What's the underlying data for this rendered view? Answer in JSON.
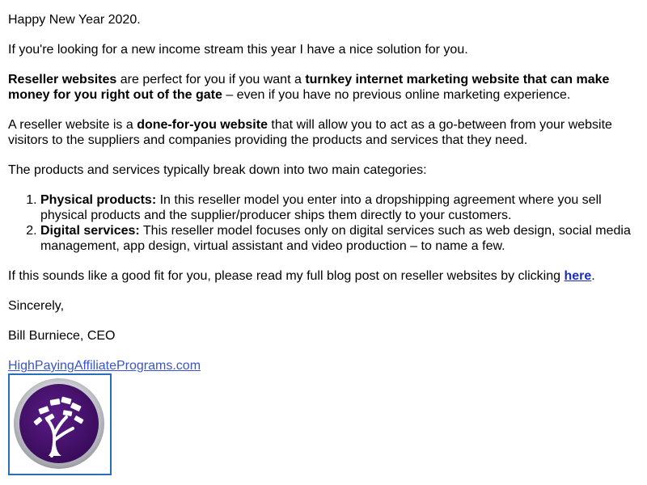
{
  "greeting": "Happy New Year 2020.",
  "intro": "If you're looking for a new income stream this year I have a nice solution for you.",
  "p2": {
    "b1": "Reseller websites",
    "t1": " are perfect for you if you want a ",
    "b2": "turnkey internet marketing website that can make money for you right out of the gate",
    "t2": " – even if you have no previous online marketing experience."
  },
  "p3": {
    "t1": "A reseller website is a ",
    "b1": "done-for-you website",
    "t2": " that will allow you to act as a go-between from your website visitors to the suppliers and companies providing the products and services that they need."
  },
  "p4": "The products and services typically break down into two main categories:",
  "categories": [
    {
      "title": "Physical products:",
      "text": " In this reseller model you enter into a dropshipping agreement where you sell physical products and the supplier/producer ships them directly to your customers."
    },
    {
      "title": "Digital services:",
      "text": " This reseller model focuses only on digital services such as web design, social media management, app design, virtual assistant and video production – to name a few."
    }
  ],
  "cta": {
    "text": "If this sounds like a good fit for you, please read my full blog post on reseller websites by clicking ",
    "link": "here",
    "end": "."
  },
  "closing": "Sincerely,",
  "signature": "Bill Burniece, CEO",
  "site_link": "HighPayingAffiliatePrograms.com",
  "colors": {
    "link": "#1a2fb8",
    "logo_purple": "#4a1470",
    "logo_ring": "#c8c8d0",
    "frame": "#2a6eb8"
  },
  "logo_icon": "money-tree-icon"
}
